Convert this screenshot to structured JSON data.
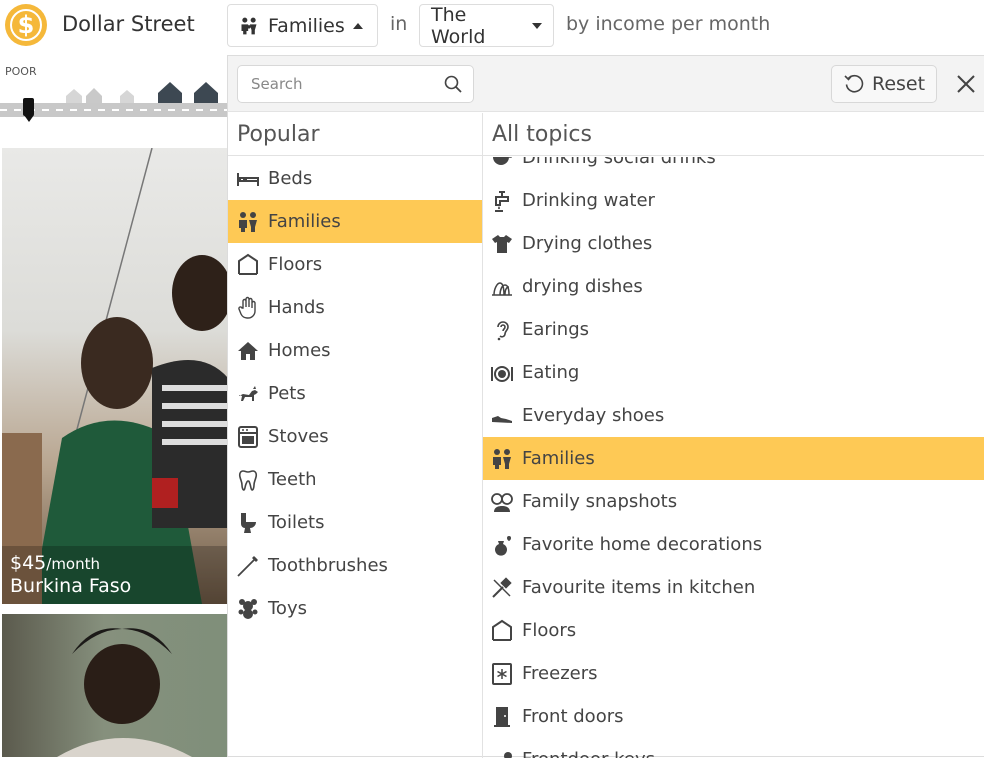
{
  "app": {
    "title": "Dollar Street",
    "logo_symbol": "$"
  },
  "colors": {
    "accent": "#fec955",
    "logo": "#f5b83a"
  },
  "header": {
    "topic_button": {
      "label": "Families",
      "icon": "families-icon"
    },
    "in_word": "in",
    "region_button": {
      "label": "The World"
    },
    "by_text": "by income per month"
  },
  "income_strip": {
    "left_label": "POOR"
  },
  "cards": [
    {
      "price": "$45",
      "unit": "/month",
      "country": "Burkina Faso"
    },
    {
      "price": "",
      "unit": "",
      "country": ""
    }
  ],
  "panel": {
    "search_placeholder": "Search",
    "reset_label": "Reset",
    "popular_heading": "Popular",
    "all_heading": "All topics",
    "popular": [
      {
        "label": "Beds",
        "icon": "bed-icon",
        "selected": false
      },
      {
        "label": "Families",
        "icon": "families-icon",
        "selected": true
      },
      {
        "label": "Floors",
        "icon": "floor-icon",
        "selected": false
      },
      {
        "label": "Hands",
        "icon": "hand-icon",
        "selected": false
      },
      {
        "label": "Homes",
        "icon": "home-icon",
        "selected": false
      },
      {
        "label": "Pets",
        "icon": "pet-icon",
        "selected": false
      },
      {
        "label": "Stoves",
        "icon": "stove-icon",
        "selected": false
      },
      {
        "label": "Teeth",
        "icon": "tooth-icon",
        "selected": false
      },
      {
        "label": "Toilets",
        "icon": "toilet-icon",
        "selected": false
      },
      {
        "label": "Toothbrushes",
        "icon": "toothbrush-icon",
        "selected": false
      },
      {
        "label": "Toys",
        "icon": "toy-icon",
        "selected": false
      }
    ],
    "all_topics": [
      {
        "label": "Drinking social drinks",
        "icon": "cup-icon",
        "selected": false
      },
      {
        "label": "Drinking water",
        "icon": "tap-icon",
        "selected": false
      },
      {
        "label": "Drying clothes",
        "icon": "shirt-icon",
        "selected": false
      },
      {
        "label": "drying dishes",
        "icon": "dish-rack-icon",
        "selected": false
      },
      {
        "label": "Earings",
        "icon": "ear-icon",
        "selected": false
      },
      {
        "label": "Eating",
        "icon": "plate-icon",
        "selected": false
      },
      {
        "label": "Everyday shoes",
        "icon": "shoe-icon",
        "selected": false
      },
      {
        "label": "Families",
        "icon": "families-icon",
        "selected": true
      },
      {
        "label": "Family snapshots",
        "icon": "family-photo-icon",
        "selected": false
      },
      {
        "label": "Favorite home decorations",
        "icon": "vase-icon",
        "selected": false
      },
      {
        "label": "Favourite items in kitchen",
        "icon": "kitchen-utensils-icon",
        "selected": false
      },
      {
        "label": "Floors",
        "icon": "floor-icon",
        "selected": false
      },
      {
        "label": "Freezers",
        "icon": "freezer-icon",
        "selected": false
      },
      {
        "label": "Front doors",
        "icon": "door-icon",
        "selected": false
      },
      {
        "label": "Frontdoor keys",
        "icon": "key-icon",
        "selected": false
      }
    ]
  }
}
